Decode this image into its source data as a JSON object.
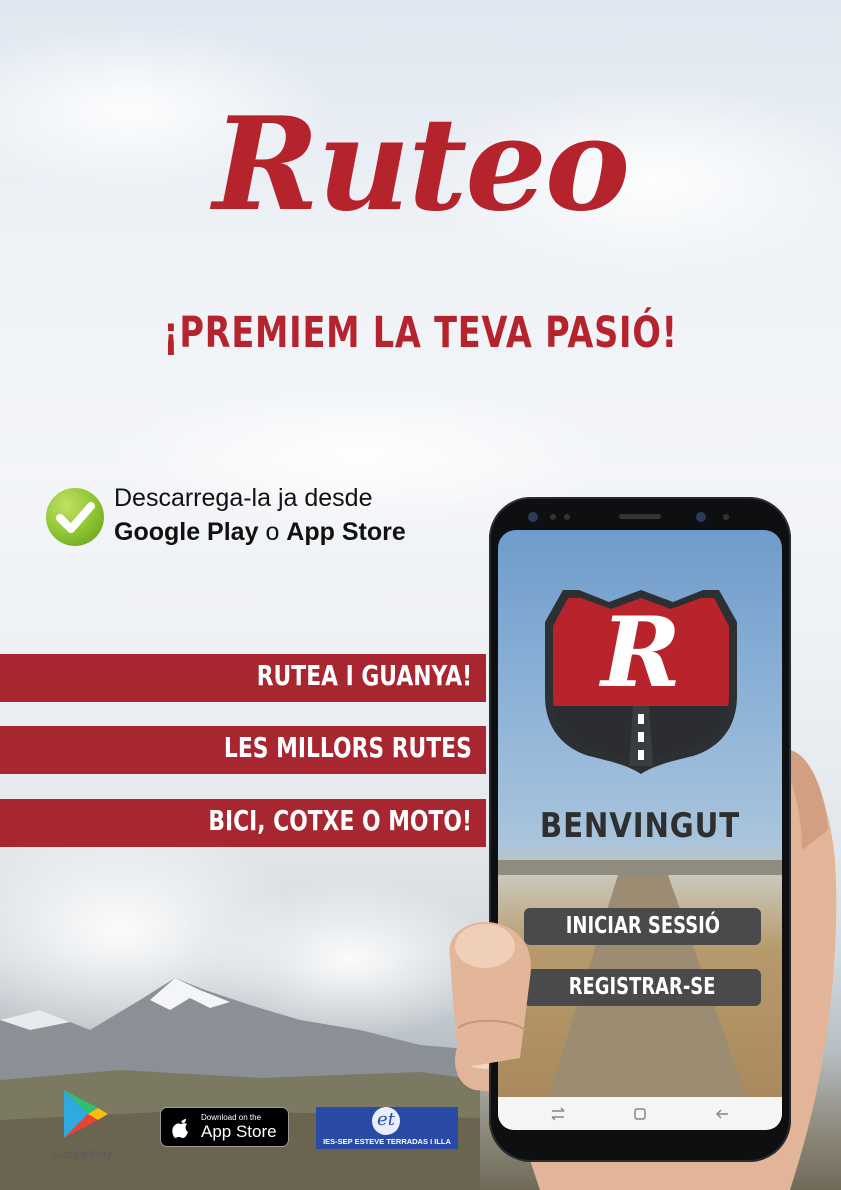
{
  "brand": {
    "name": "Ruteo",
    "slogan": "¡PREMIEM LA TEVA PASIÓ!",
    "color": "#b5232d"
  },
  "download": {
    "line1": "Descarrega-la ja desde",
    "store_a": "Google Play",
    "connector": "o",
    "store_b": "App Store",
    "icon": "check-icon"
  },
  "banners": [
    {
      "label": "RUTEA I GUANYA!"
    },
    {
      "label": "LES MILLORS RUTES"
    },
    {
      "label": "BICI, COTXE O MOTO!"
    }
  ],
  "app_screen": {
    "logo_letter": "R",
    "welcome": "BENVINGUT",
    "login_button": "INICIAR SESSIÓ",
    "register_button": "REGISTRAR-SE",
    "nav_icons": [
      "recent-apps-icon",
      "home-icon",
      "back-icon"
    ]
  },
  "footer": {
    "google_play_label": "Google Play",
    "app_store_small": "Download on the",
    "app_store_big": "App Store",
    "school_logo_text": "et",
    "school_name": "IES-SEP ESTEVE TERRADAS I ILLA"
  }
}
